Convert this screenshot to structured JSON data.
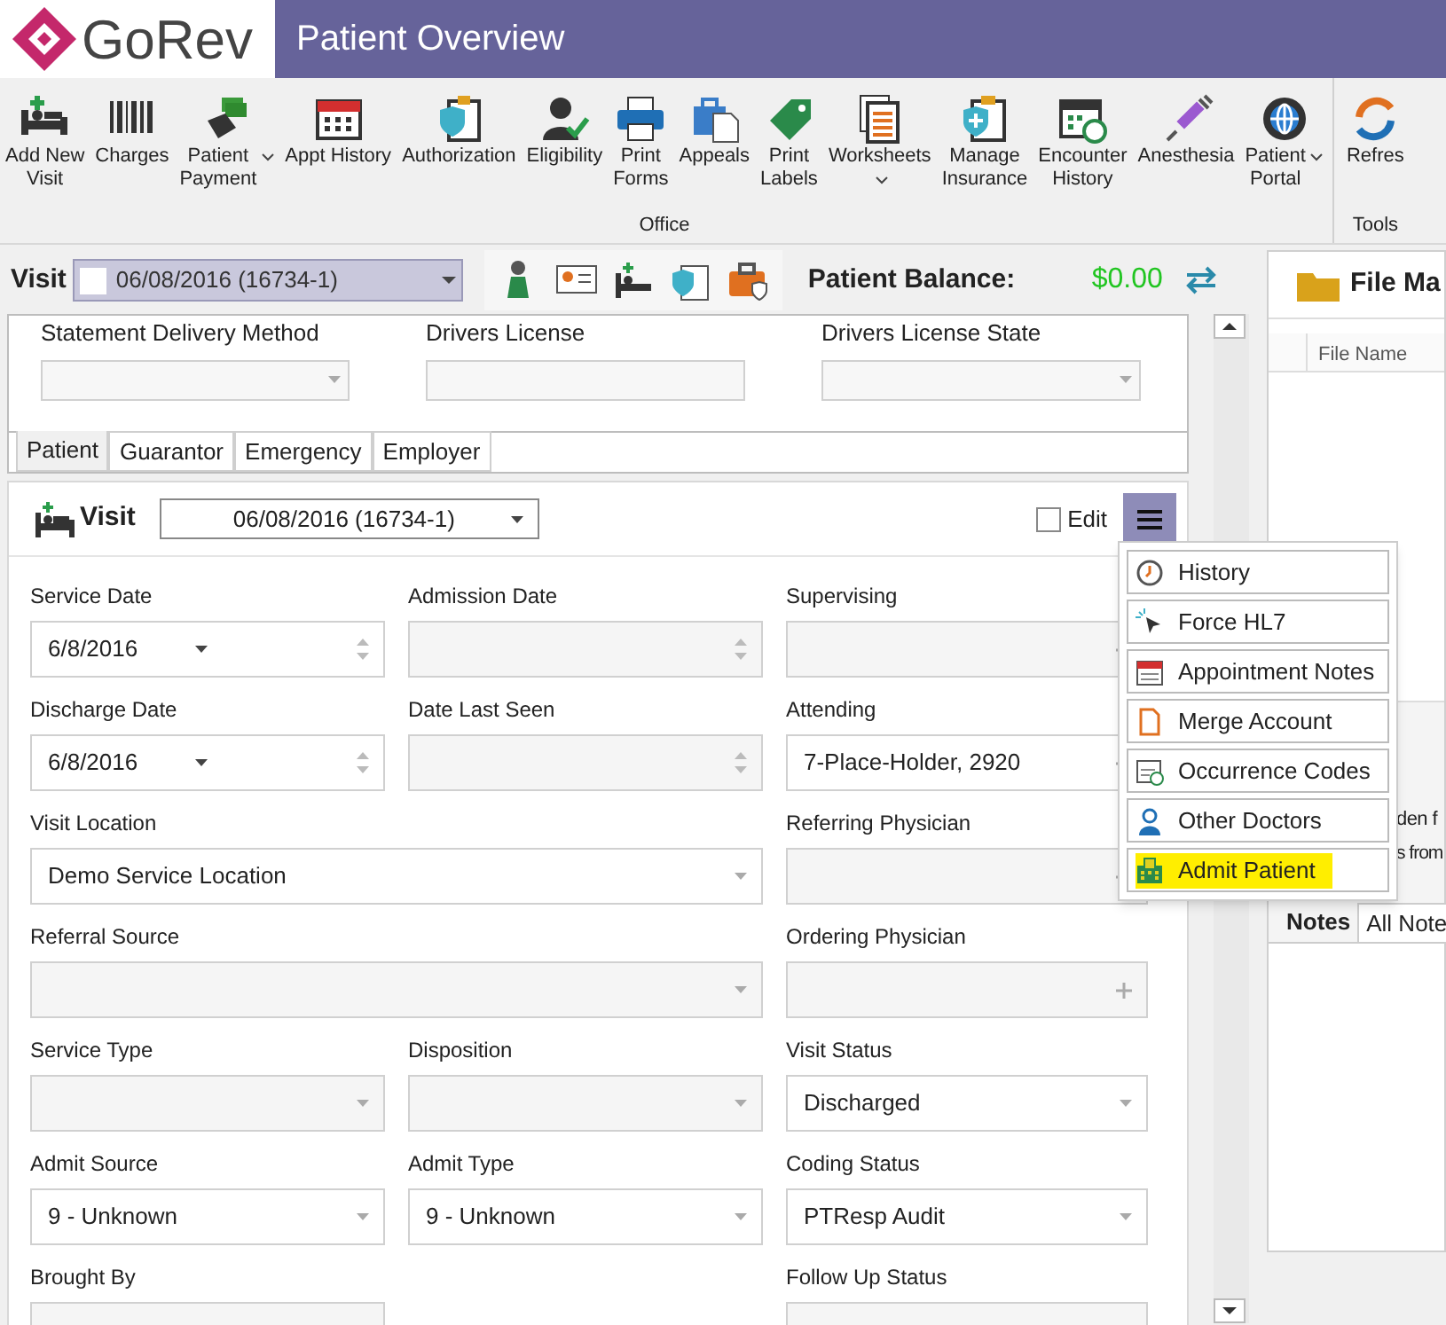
{
  "header": {
    "logo": "GoRev",
    "title": "Patient Overview"
  },
  "toolbar": {
    "groups": [
      {
        "label": "Office",
        "items": [
          {
            "label": "Add New\nVisit",
            "dropdown": false
          },
          {
            "label": "Charges",
            "dropdown": false
          },
          {
            "label": "Patient\nPayment",
            "dropdown": true
          },
          {
            "label": "Appt History",
            "dropdown": false
          },
          {
            "label": "Authorization",
            "dropdown": false
          },
          {
            "label": "Eligibility",
            "dropdown": false
          },
          {
            "label": "Print\nForms",
            "dropdown": false
          },
          {
            "label": "Appeals",
            "dropdown": false
          },
          {
            "label": "Print\nLabels",
            "dropdown": false
          },
          {
            "label": "Worksheets",
            "dropdown": true
          },
          {
            "label": "Manage\nInsurance",
            "dropdown": false
          },
          {
            "label": "Encounter\nHistory",
            "dropdown": false
          },
          {
            "label": "Anesthesia",
            "dropdown": false
          },
          {
            "label": "Patient\nPortal",
            "dropdown": true
          }
        ]
      },
      {
        "label": "Tools",
        "items": [
          {
            "label": "Refres",
            "dropdown": false
          }
        ]
      }
    ]
  },
  "visit_bar": {
    "label": "Visit",
    "value": "06/08/2016 (16734-1)",
    "balance_label": "Patient Balance:",
    "balance": "$0.00"
  },
  "contact_section": {
    "fields": [
      {
        "label": "Statement Delivery Method",
        "kind": "dropdown"
      },
      {
        "label": "Drivers License",
        "kind": "text"
      },
      {
        "label": "Drivers License State",
        "kind": "dropdown"
      }
    ],
    "tabs": [
      {
        "label": "Patient",
        "selected": true
      },
      {
        "label": "Guarantor",
        "selected": false
      },
      {
        "label": "Emergency",
        "selected": false
      },
      {
        "label": "Employer",
        "selected": false
      }
    ]
  },
  "visit_section": {
    "title": "Visit",
    "value": "06/08/2016 (16734-1)",
    "edit_label": "Edit",
    "edit_checked": false,
    "menu_open": true,
    "fields": [
      {
        "label": "Service Date",
        "kind": "date",
        "value": "6/8/2016",
        "wide": false
      },
      {
        "label": "Admission Date",
        "kind": "date",
        "wide": false
      },
      {
        "label": "Supervising",
        "kind": "lookup",
        "wide": false
      },
      {
        "label": "Discharge Date",
        "kind": "date",
        "value": "6/8/2016",
        "wide": false
      },
      {
        "label": "Date Last Seen",
        "kind": "date",
        "wide": false
      },
      {
        "label": "Attending",
        "kind": "lookup",
        "value": "7-Place-Holder, 2920",
        "wide": false
      },
      {
        "label": "Visit Location",
        "kind": "dropdown",
        "value": "Demo Service Location",
        "wide": true
      },
      {
        "label": "Referring Physician",
        "kind": "lookup",
        "wide": false
      },
      {
        "label": "Referral Source",
        "kind": "dropdown",
        "wide": true
      },
      {
        "label": "Ordering Physician",
        "kind": "lookup",
        "wide": false
      },
      {
        "label": "Service Type",
        "kind": "dropdown",
        "wide": false
      },
      {
        "label": "Disposition",
        "kind": "dropdown",
        "wide": false
      },
      {
        "label": "Visit Status",
        "kind": "dropdown",
        "value": "Discharged",
        "wide": false
      },
      {
        "label": "Admit Source",
        "kind": "dropdown",
        "value": "9 - Unknown",
        "wide": false
      },
      {
        "label": "Admit Type",
        "kind": "dropdown",
        "value": "9 - Unknown",
        "wide": false
      },
      {
        "label": "Coding Status",
        "kind": "dropdown",
        "value": "PTResp Audit",
        "wide": false
      },
      {
        "label": "Brought By",
        "kind": "dropdown",
        "wide": false
      },
      {
        "kind": "none"
      },
      {
        "label": "Follow Up Status",
        "kind": "dropdown",
        "wide": false
      }
    ]
  },
  "visit_menu": [
    {
      "label": "History",
      "highlighted": false
    },
    {
      "label": "Force HL7",
      "highlighted": false
    },
    {
      "label": "Appointment Notes",
      "highlighted": false
    },
    {
      "label": "Merge Account",
      "highlighted": false
    },
    {
      "label": "Occurrence Codes",
      "highlighted": false
    },
    {
      "label": "Other Doctors",
      "highlighted": false
    },
    {
      "label": "Admit Patient",
      "highlighted": true
    }
  ],
  "file_panel": {
    "title": "File Ma",
    "columns": [
      "File Name"
    ],
    "text_1": "den f",
    "text_2": "s from"
  },
  "notes_tabs": [
    {
      "label": "Notes",
      "selected": true
    },
    {
      "label": "All Note",
      "selected": false
    }
  ]
}
